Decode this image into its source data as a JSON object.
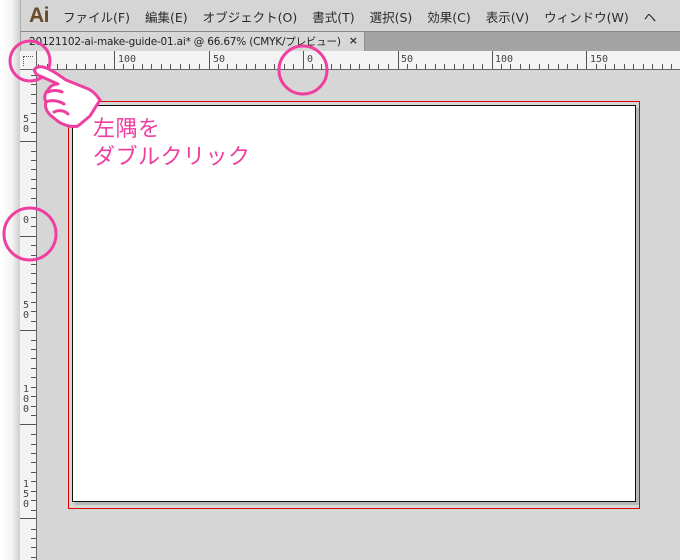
{
  "app": {
    "logo": "Ai",
    "menu": [
      {
        "label": "ファイル(F)"
      },
      {
        "label": "編集(E)"
      },
      {
        "label": "オブジェクト(O)"
      },
      {
        "label": "書式(T)"
      },
      {
        "label": "選択(S)"
      },
      {
        "label": "効果(C)"
      },
      {
        "label": "表示(V)"
      },
      {
        "label": "ウィンドウ(W)"
      },
      {
        "label": "ヘ"
      }
    ]
  },
  "document_tab": {
    "title": "20121102-ai-make-guide-01.ai* @ 66.67% (CMYK/プレビュー)",
    "close_icon": "×"
  },
  "rulers": {
    "horizontal_labels": [
      "100",
      "50",
      "0",
      "50",
      "100",
      "150"
    ],
    "vertical_labels": [
      "50",
      "0",
      "50",
      "100",
      "150"
    ]
  },
  "annotation": {
    "line1": "左隅を",
    "line2": "ダブルクリック",
    "highlight_color": "#ee3fa0",
    "icon": "pointing-hand-icon"
  },
  "colors": {
    "bleed_line": "#e00000",
    "canvas_bg": "#d6d6d6",
    "logo": "#6b4a2a"
  }
}
